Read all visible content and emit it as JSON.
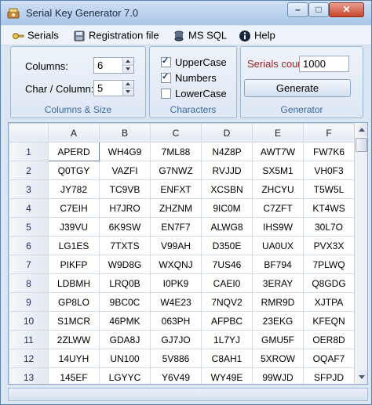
{
  "window": {
    "title": "Serial Key Generator 7.0"
  },
  "menu": [
    {
      "label": "Serials",
      "icon": "key-icon"
    },
    {
      "label": "Registration file",
      "icon": "disk-icon"
    },
    {
      "label": "MS SQL",
      "icon": "database-icon"
    },
    {
      "label": "Help",
      "icon": "info-icon"
    }
  ],
  "columns_size": {
    "caption": "Columns & Size",
    "columns_label": "Columns:",
    "columns_value": "6",
    "char_label": "Char / Column:",
    "char_value": "5"
  },
  "characters": {
    "caption": "Characters",
    "options": [
      {
        "label": "UpperCase",
        "checked": true
      },
      {
        "label": "Numbers",
        "checked": true
      },
      {
        "label": "LowerCase",
        "checked": false
      }
    ]
  },
  "generator": {
    "caption": "Generator",
    "count_label": "Serials count:",
    "count_value": "1000",
    "button_label": "Generate"
  },
  "grid": {
    "columns": [
      "A",
      "B",
      "C",
      "D",
      "E",
      "F"
    ],
    "rows": [
      {
        "n": "1",
        "cells": [
          "APERD",
          "WH4G9",
          "7ML88",
          "N4Z8P",
          "AWT7W",
          "FW7K6"
        ]
      },
      {
        "n": "2",
        "cells": [
          "Q0TGY",
          "VAZFI",
          "G7NWZ",
          "RVJJD",
          "SX5M1",
          "VH0F3"
        ]
      },
      {
        "n": "3",
        "cells": [
          "JY782",
          "TC9VB",
          "ENFXT",
          "XCSBN",
          "ZHCYU",
          "T5W5L"
        ]
      },
      {
        "n": "4",
        "cells": [
          "C7EIH",
          "H7JRO",
          "ZHZNM",
          "9IC0M",
          "C7ZFT",
          "KT4WS"
        ]
      },
      {
        "n": "5",
        "cells": [
          "J39VU",
          "6K9SW",
          "EN7F7",
          "ALWG8",
          "IHS9W",
          "30L7O"
        ]
      },
      {
        "n": "6",
        "cells": [
          "LG1ES",
          "7TXTS",
          "V99AH",
          "D350E",
          "UA0UX",
          "PVX3X"
        ]
      },
      {
        "n": "7",
        "cells": [
          "PIKFP",
          "W9D8G",
          "WXQNJ",
          "7US46",
          "BF794",
          "7PLWQ"
        ]
      },
      {
        "n": "8",
        "cells": [
          "LDBMH",
          "LRQ0B",
          "I0PK9",
          "CAEI0",
          "3ERAY",
          "Q8GDG"
        ]
      },
      {
        "n": "9",
        "cells": [
          "GP8LO",
          "9BC0C",
          "W4E23",
          "7NQV2",
          "RMR9D",
          "XJTPA"
        ]
      },
      {
        "n": "10",
        "cells": [
          "S1MCR",
          "46PMK",
          "063PH",
          "AFPBC",
          "23EKG",
          "KFEQN"
        ]
      },
      {
        "n": "11",
        "cells": [
          "2ZLWW",
          "GDA8J",
          "GJ7JO",
          "1L7YJ",
          "GMU5F",
          "OER8D"
        ]
      },
      {
        "n": "12",
        "cells": [
          "14UYH",
          "UN100",
          "5V886",
          "C8AH1",
          "5XROW",
          "OQAF7"
        ]
      },
      {
        "n": "13",
        "cells": [
          "145EF",
          "LGYYC",
          "Y6V49",
          "WY49E",
          "99WJD",
          "SFPJD"
        ]
      }
    ]
  }
}
